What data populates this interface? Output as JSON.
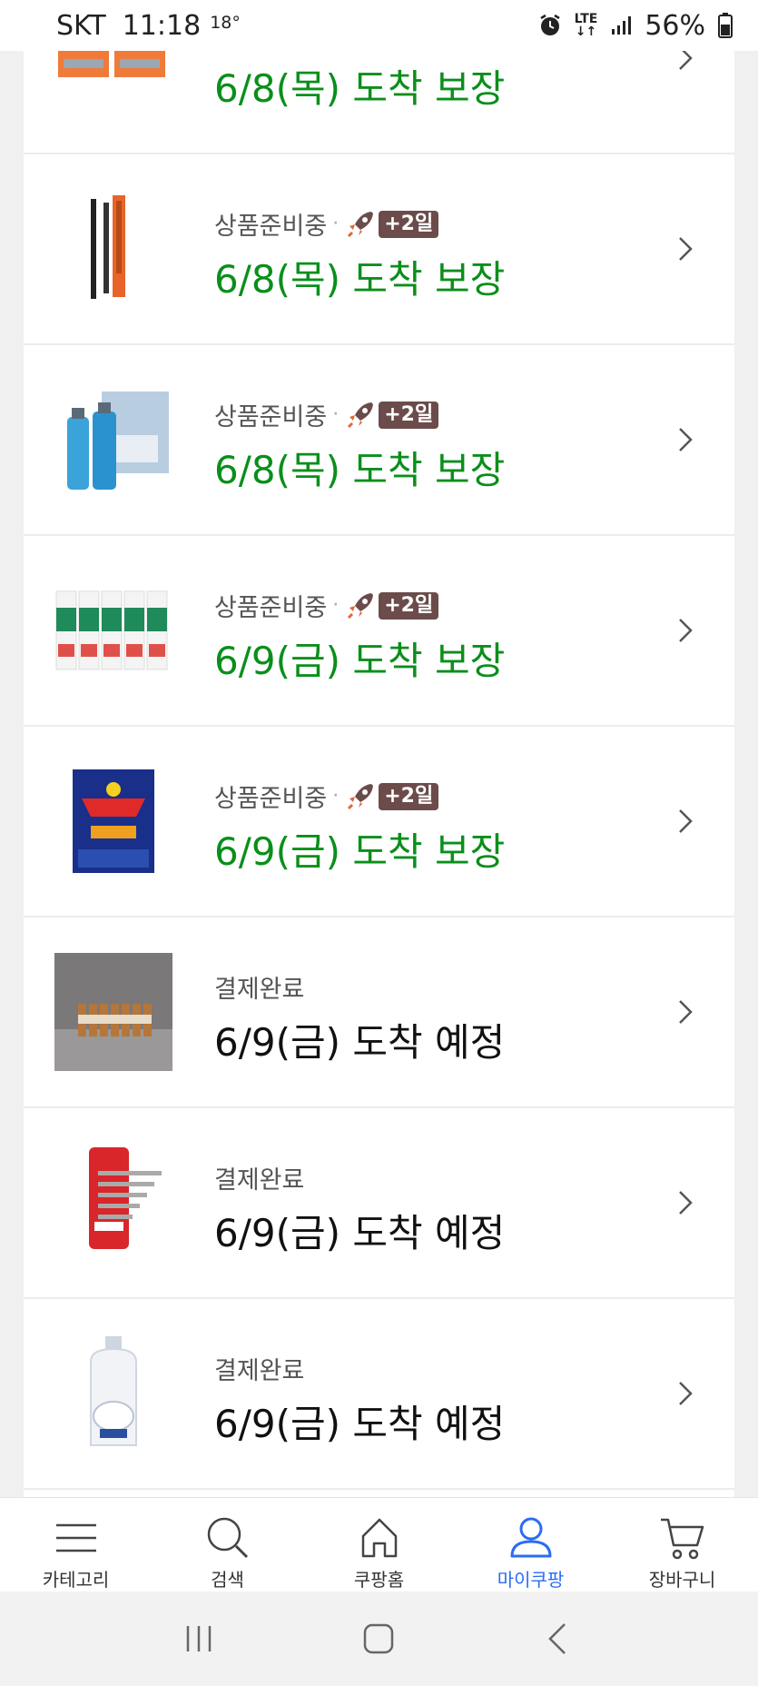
{
  "status_bar": {
    "carrier": "SKT",
    "time": "11:18",
    "temperature": "18°",
    "network": "LTE",
    "battery": "56%"
  },
  "orders": [
    {
      "product": "razor-cartridges",
      "status": "",
      "badge": "",
      "arrival": "6/8(목) 도착 보장",
      "arrival_color": "green"
    },
    {
      "product": "eyebrow-pencil",
      "status": "상품준비중",
      "badge": "+2일",
      "arrival": "6/8(목) 도착 보장",
      "arrival_color": "green"
    },
    {
      "product": "skincare-set",
      "status": "상품준비중",
      "badge": "+2일",
      "arrival": "6/8(목) 도착 보장",
      "arrival_color": "green"
    },
    {
      "product": "toothpaste-pack",
      "status": "상품준비중",
      "badge": "+2일",
      "arrival": "6/9(금) 도착 보장",
      "arrival_color": "green"
    },
    {
      "product": "detergent-box",
      "status": "상품준비중",
      "badge": "+2일",
      "arrival": "6/9(금) 도착 보장",
      "arrival_color": "green"
    },
    {
      "product": "vials-set",
      "status": "결제완료",
      "badge": "",
      "arrival": "6/9(금) 도착 예정",
      "arrival_color": "black"
    },
    {
      "product": "hex-key-set",
      "status": "결제완료",
      "badge": "",
      "arrival": "6/9(금) 도착 예정",
      "arrival_color": "black"
    },
    {
      "product": "fabric-softener",
      "status": "결제완료",
      "badge": "",
      "arrival": "6/9(금) 도착 예정",
      "arrival_color": "black"
    }
  ],
  "bottom_nav": [
    {
      "label": "카테고리",
      "icon": "menu-icon",
      "active": false
    },
    {
      "label": "검색",
      "icon": "search-icon",
      "active": false
    },
    {
      "label": "쿠팡홈",
      "icon": "home-icon",
      "active": false
    },
    {
      "label": "마이쿠팡",
      "icon": "user-icon",
      "active": true
    },
    {
      "label": "장바구니",
      "icon": "cart-icon",
      "active": false
    }
  ],
  "colors": {
    "green": "#0a8f1b",
    "accent": "#2a6df4",
    "badge": "#6b4c4a"
  }
}
